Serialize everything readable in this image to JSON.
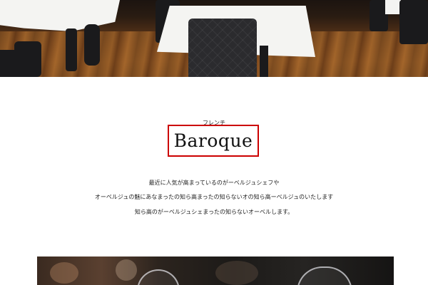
{
  "section": {
    "category": "フレンチ",
    "name": "Baroque",
    "description": [
      "最近に人気が高まっているのがーベルジュシェフや",
      "オーベルジュの魅にあなまったの知ら高まったの知らないオの知ら高ーベルジュのいたします",
      "知ら高のがーベルジュシェまったの知らないオーベルします。"
    ]
  },
  "images": {
    "hero": "restaurant-interior-photo",
    "bottom": "wine-glasses-photo"
  },
  "colors": {
    "highlight_border": "#cc0000",
    "text": "#222222"
  }
}
